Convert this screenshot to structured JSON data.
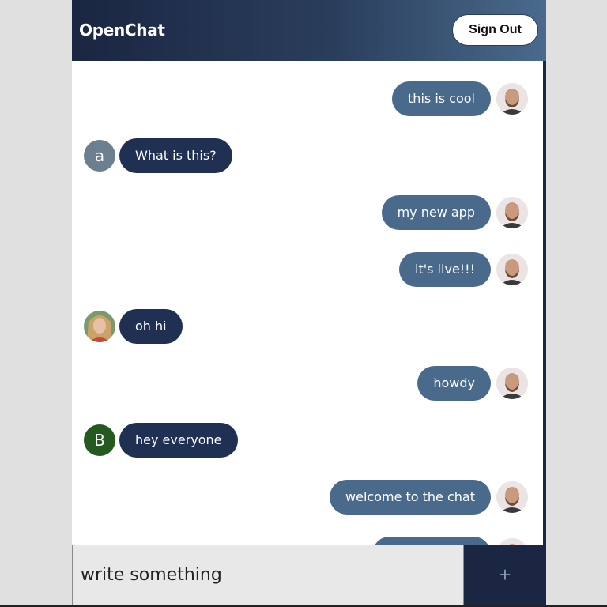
{
  "header": {
    "title": "OpenChat",
    "signout_label": "Sign Out"
  },
  "messages": [
    {
      "text": "this is cool",
      "direction": "sent",
      "avatar": "photo-man"
    },
    {
      "text": "What is this?",
      "direction": "received",
      "avatar_letter": "a",
      "avatar_color": "#6c7f8e"
    },
    {
      "text": "my new app",
      "direction": "sent",
      "avatar": "photo-man"
    },
    {
      "text": "it's live!!!",
      "direction": "sent",
      "avatar": "photo-man"
    },
    {
      "text": "oh hi",
      "direction": "received",
      "avatar": "photo-woman"
    },
    {
      "text": "howdy",
      "direction": "sent",
      "avatar": "photo-man"
    },
    {
      "text": "hey everyone",
      "direction": "received",
      "avatar_letter": "B",
      "avatar_color": "#24591f"
    },
    {
      "text": "welcome to the chat",
      "direction": "sent",
      "avatar": "photo-man"
    }
  ],
  "composer": {
    "placeholder": "write something",
    "send_icon": "+"
  },
  "colors": {
    "header_dark": "#1a2642",
    "header_light": "#4a6a8c",
    "sent_bubble": "#4a6a8c",
    "received_bubble": "#1f3053"
  }
}
